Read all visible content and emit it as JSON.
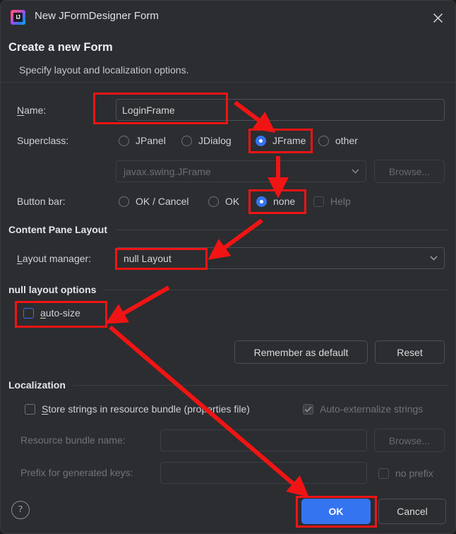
{
  "window": {
    "title": "New JFormDesigner Form",
    "app_icon": "intellij-idea-icon",
    "app_icon_text": "IJ",
    "close_icon": "close-icon"
  },
  "header": {
    "title": "Create a new Form",
    "subtitle": "Specify layout and localization options."
  },
  "form": {
    "name_label": "Name:",
    "name_value": "LoginFrame",
    "superclass_label": "Superclass:",
    "superclass_options": [
      {
        "label": "JPanel",
        "selected": false
      },
      {
        "label": "JDialog",
        "selected": false
      },
      {
        "label": "JFrame",
        "selected": true
      },
      {
        "label": "other",
        "selected": false
      }
    ],
    "superclass_combo_value": "javax.swing.JFrame",
    "superclass_browse_label": "Browse...",
    "buttonbar_label": "Button bar:",
    "buttonbar_options": [
      {
        "label": "OK / Cancel",
        "selected": false
      },
      {
        "label": "OK",
        "selected": false
      },
      {
        "label": "none",
        "selected": true
      }
    ],
    "help_checkbox_label": "Help",
    "help_checkbox_checked": false,
    "help_checkbox_enabled": false
  },
  "content_pane": {
    "section_title": "Content Pane Layout",
    "layout_manager_label": "Layout manager:",
    "layout_manager_value": "null Layout"
  },
  "null_layout": {
    "section_title": "null layout options",
    "auto_size_label": "auto-size",
    "auto_size_checked": false
  },
  "actions": {
    "remember_label": "Remember as default",
    "reset_label": "Reset"
  },
  "localization": {
    "section_title": "Localization",
    "store_strings_label": "Store strings in resource bundle (properties file)",
    "store_strings_checked": false,
    "auto_externalize_label": "Auto-externalize strings",
    "auto_externalize_checked": true,
    "auto_externalize_enabled": false,
    "bundle_name_label": "Resource bundle name:",
    "bundle_name_value": "",
    "bundle_browse_label": "Browse...",
    "prefix_label": "Prefix for generated keys:",
    "prefix_value": "",
    "no_prefix_label": "no prefix",
    "no_prefix_checked": false
  },
  "footer": {
    "help_icon": "question-mark-icon",
    "ok_label": "OK",
    "cancel_label": "Cancel"
  },
  "annotations": {
    "highlight_color": "#f11414",
    "boxes": [
      "name-field-highlight",
      "jframe-radio-highlight",
      "none-radio-highlight",
      "layout-manager-highlight",
      "auto-size-highlight",
      "ok-button-highlight"
    ],
    "arrow_count": 5
  },
  "theme": {
    "background": "#2b2d30",
    "accent": "#3574f0",
    "text": "#d6d6d6"
  }
}
